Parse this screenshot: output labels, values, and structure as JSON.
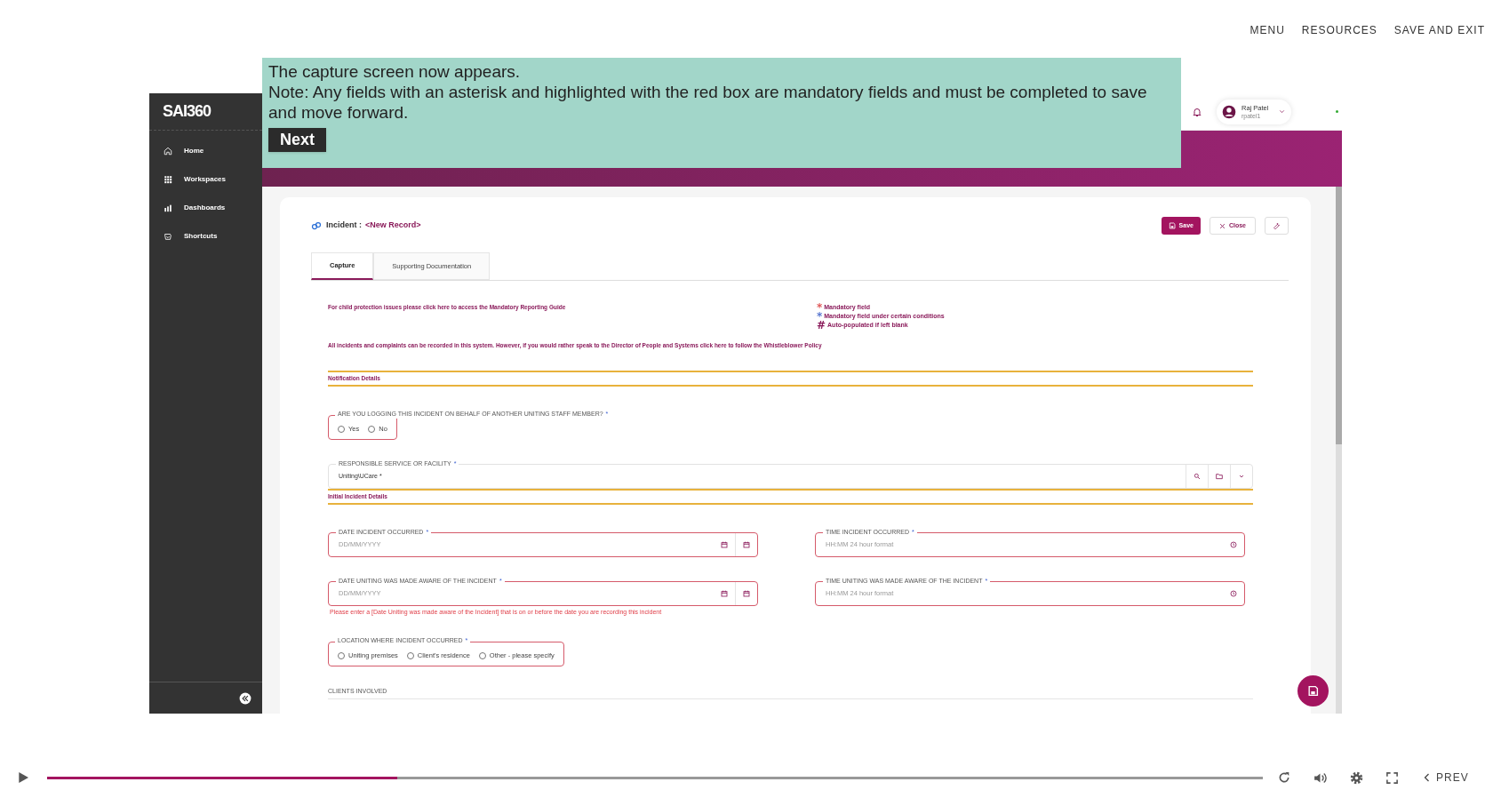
{
  "top_nav": [
    "MENU",
    "RESOURCES",
    "SAVE AND EXIT"
  ],
  "overlay": {
    "lines": [
      "The capture screen now appears.",
      "Note: Any fields with an asterisk and highlighted with the red box are mandatory fields and must be completed to save and move forward."
    ],
    "button": "Next"
  },
  "app": {
    "logo": "SAI360",
    "sidebar": [
      {
        "label": "Home"
      },
      {
        "label": "Workspaces"
      },
      {
        "label": "Dashboards"
      },
      {
        "label": "Shortcuts"
      }
    ],
    "user": {
      "name": "Raj Patel",
      "id": "rpatel1"
    },
    "record": {
      "label": "Incident :",
      "value": "<New Record>"
    },
    "actions": {
      "save": "Save",
      "close": "Close"
    },
    "tabs": [
      {
        "label": "Capture",
        "selected": true
      },
      {
        "label": "Supporting Documentation",
        "selected": false
      }
    ],
    "notice_1": "For child protection issues please click here to access the Mandatory Reporting Guide",
    "legend": [
      {
        "mark": "*",
        "text": "Mandatory field",
        "color": "#e05a5a"
      },
      {
        "mark": "*",
        "text": "Mandatory field under certain conditions",
        "color": "#5a78d0"
      },
      {
        "mark": "#",
        "text": "Auto-populated if left blank",
        "color": "#8a1a5a"
      }
    ],
    "notice_2": "All incidents and complaints can be recorded in this system. However, if you would rather speak to the Director of People and Systems click here to follow the Whistleblower Policy",
    "sections": [
      {
        "title": "Notification Details",
        "rows": [
          [
            {
              "kind": "radio",
              "label": "ARE YOU LOGGING THIS INCIDENT ON BEHALF OF ANOTHER UNITING STAFF MEMBER?",
              "required_mark": "*",
              "highlighted": true,
              "options": [
                {
                  "label": "Yes",
                  "selected": false
                },
                {
                  "label": "No",
                  "selected": false
                }
              ]
            }
          ],
          [
            {
              "kind": "lookup",
              "label": "RESPONSIBLE SERVICE OR FACILITY",
              "required_mark": "*",
              "highlighted": false,
              "value": "Uniting\\UCare *"
            }
          ]
        ]
      },
      {
        "title": "Initial Incident Details",
        "rows": [
          [
            {
              "kind": "date",
              "label": "DATE INCIDENT OCCURRED",
              "required_mark": "*",
              "highlighted": true,
              "placeholder": "DD/MM/YYYY"
            },
            {
              "kind": "time",
              "label": "TIME INCIDENT OCCURRED",
              "required_mark": "*",
              "highlighted": true,
              "placeholder": "HH:MM 24 hour format"
            }
          ],
          [
            {
              "kind": "date",
              "label": "DATE UNITING WAS MADE AWARE OF THE INCIDENT",
              "required_mark": "*",
              "highlighted": true,
              "placeholder": "DD/MM/YYYY",
              "error": "Please enter a [Date Uniting was made aware of the Incident] that is on or before the date you are recording this incident"
            },
            {
              "kind": "time",
              "label": "TIME UNITING WAS MADE AWARE OF THE INCIDENT",
              "required_mark": "*",
              "highlighted": true,
              "placeholder": "HH:MM 24 hour format"
            }
          ],
          [
            {
              "kind": "radio",
              "label": "LOCATION WHERE INCIDENT OCCURRED",
              "required_mark": "*",
              "highlighted": true,
              "options": [
                {
                  "label": "Uniting premises",
                  "selected": false
                },
                {
                  "label": "Client's residence",
                  "selected": false
                },
                {
                  "label": "Other - please specify",
                  "selected": false
                }
              ]
            }
          ],
          [
            {
              "kind": "heading",
              "label": "CLIENTS INVOLVED"
            }
          ]
        ]
      }
    ]
  },
  "player": {
    "level": 0.288,
    "prev": "PREV"
  }
}
